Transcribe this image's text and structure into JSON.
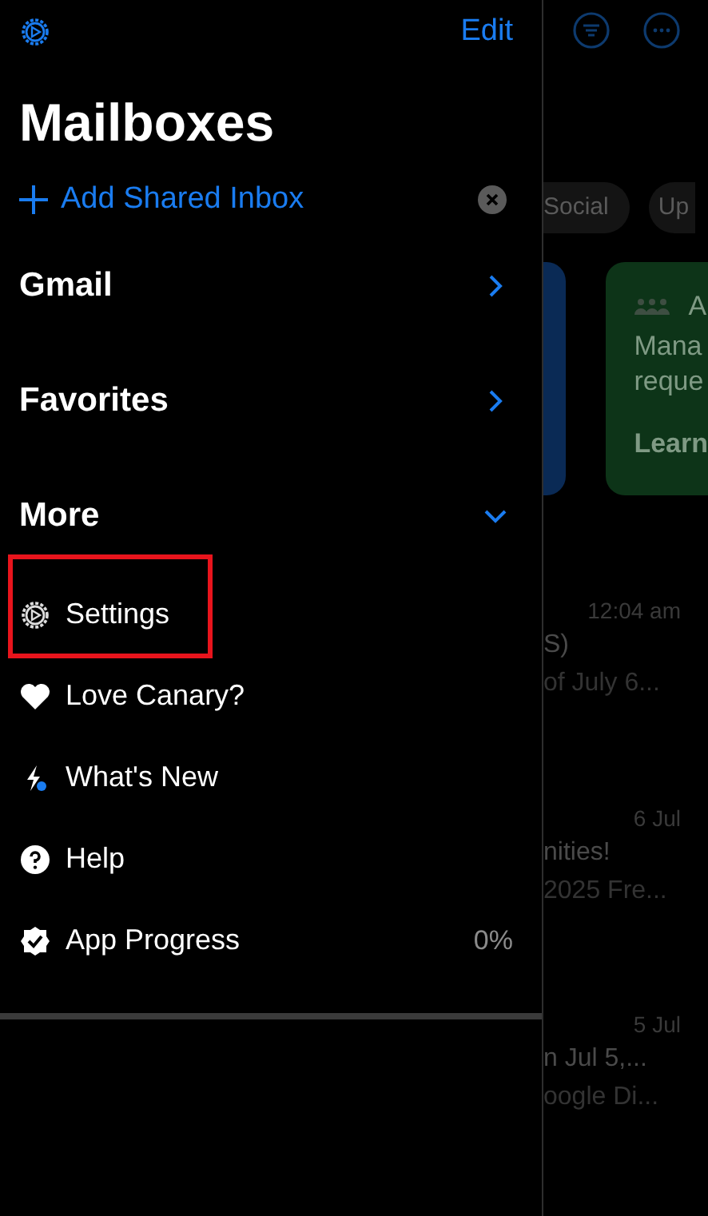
{
  "drawer": {
    "edit": "Edit",
    "title": "Mailboxes",
    "add_shared_inbox": "Add Shared Inbox",
    "sections": [
      {
        "label": "Gmail",
        "expanded": false
      },
      {
        "label": "Favorites",
        "expanded": false
      },
      {
        "label": "More",
        "expanded": true
      }
    ],
    "items": [
      {
        "kind": "settings",
        "label": "Settings",
        "highlighted": true
      },
      {
        "kind": "heart",
        "label": "Love Canary?",
        "highlighted": false
      },
      {
        "kind": "whats-new",
        "label": "What's New",
        "highlighted": false
      },
      {
        "kind": "help",
        "label": "Help",
        "highlighted": false
      },
      {
        "kind": "progress",
        "label": "App Progress",
        "value": "0%",
        "highlighted": false
      }
    ]
  },
  "background": {
    "chips": [
      "Social",
      "Up"
    ],
    "card": {
      "heading": "A",
      "lines": [
        "Mana",
        "reque"
      ],
      "link": "Learn"
    },
    "emails": [
      {
        "time": "12:04 am",
        "subject": "S)",
        "preview": "of July 6..."
      },
      {
        "time": "6 Jul",
        "subject": "nities!",
        "preview": "2025 Fre..."
      },
      {
        "time": "5 Jul",
        "subject": "n Jul 5,...",
        "preview": "oogle Di..."
      }
    ]
  }
}
